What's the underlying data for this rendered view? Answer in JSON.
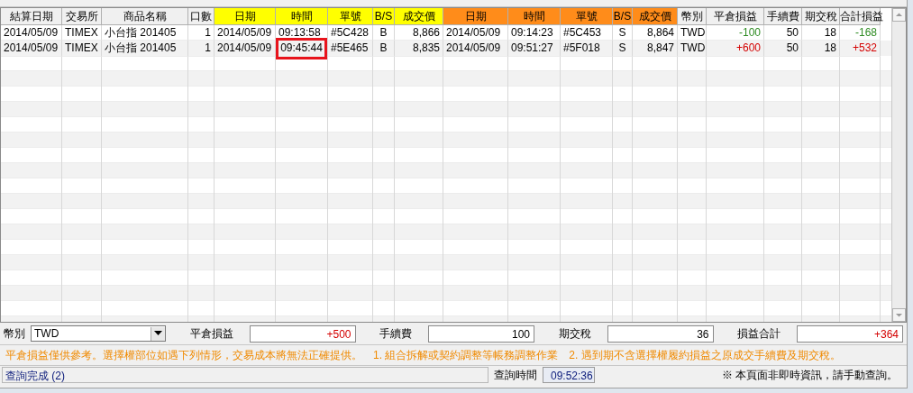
{
  "columns": [
    {
      "label": "結算日期",
      "color": "#f0f0f0"
    },
    {
      "label": "交易所",
      "color": "#f0f0f0"
    },
    {
      "label": "商品名稱",
      "color": "#f0f0f0"
    },
    {
      "label": "口數",
      "color": "#f0f0f0"
    },
    {
      "label": "日期",
      "color": "#ffff00"
    },
    {
      "label": "時間",
      "color": "#ffff00"
    },
    {
      "label": "單號",
      "color": "#ffff00"
    },
    {
      "label": "B/S",
      "color": "#ffff00"
    },
    {
      "label": "成交價",
      "color": "#ffff00"
    },
    {
      "label": "日期",
      "color": "#ff8c1a"
    },
    {
      "label": "時間",
      "color": "#ff8c1a"
    },
    {
      "label": "單號",
      "color": "#ff8c1a"
    },
    {
      "label": "B/S",
      "color": "#ff8c1a"
    },
    {
      "label": "成交價",
      "color": "#ff8c1a"
    },
    {
      "label": "幣別",
      "color": "#f0f0f0"
    },
    {
      "label": "平倉損益",
      "color": "#f0f0f0"
    },
    {
      "label": "手續費",
      "color": "#f0f0f0"
    },
    {
      "label": "期交稅",
      "color": "#f0f0f0"
    },
    {
      "label": "合計損益",
      "color": "#f0f0f0"
    }
  ],
  "rows": [
    {
      "cells": [
        "2014/05/09",
        "TIMEX",
        "小台指 201405",
        "1",
        "2014/05/09",
        "09:13:58",
        "#5C428",
        "B",
        "8,866",
        "2014/05/09",
        "09:14:23",
        "#5C453",
        "S",
        "8,864",
        "TWD",
        "-100",
        "50",
        "18",
        "-168"
      ],
      "color": "#2e8b22",
      "open_time_highlighted": false
    },
    {
      "cells": [
        "2014/05/09",
        "TIMEX",
        "小台指 201405",
        "1",
        "2014/05/09",
        "09:45:44",
        "#5E465",
        "B",
        "8,835",
        "2014/05/09",
        "09:51:27",
        "#5F018",
        "S",
        "8,847",
        "TWD",
        "+600",
        "50",
        "18",
        "+532"
      ],
      "color": "#d40000",
      "open_time_highlighted": true
    }
  ],
  "summary": {
    "currency_label": "幣別",
    "currency": "TWD",
    "fields": [
      {
        "label": "平倉損益",
        "value": "+500",
        "color": "#d40000"
      },
      {
        "label": "手續費",
        "value": "100",
        "color": "#000000"
      },
      {
        "label": "期交稅",
        "value": "36",
        "color": "#000000"
      },
      {
        "label": "損益合計",
        "value": "+364",
        "color": "#d40000"
      }
    ]
  },
  "notice": "平倉損益僅供參考。選擇權部位如遇下列情形，交易成本將無法正確提供。　1. 組合拆解或契約調整等帳務調整作業　2. 遇到期不含選擇權履約損益之原成交手續費及期交稅。",
  "status_bar": {
    "message": "查詢完成 (2)",
    "time_label": "查詢時間",
    "time": "09:52:36",
    "note": "※ 本頁面非即時資訊，請手動查詢。"
  }
}
